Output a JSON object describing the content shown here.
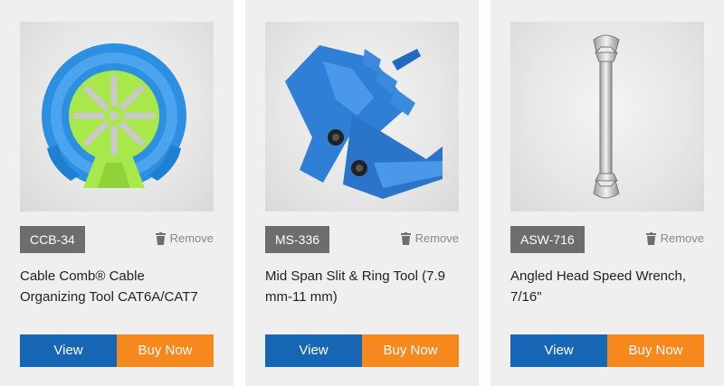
{
  "products": [
    {
      "sku": "CCB-34",
      "remove_label": "Remove",
      "title": "Cable Comb® Cable Organizing Tool CAT6A/CAT7",
      "view_label": "View",
      "buy_label": "Buy Now",
      "image_icon": "cable-comb-tool-image"
    },
    {
      "sku": "MS-336",
      "remove_label": "Remove",
      "title": "Mid Span Slit & Ring Tool (7.9 mm-11 mm)",
      "view_label": "View",
      "buy_label": "Buy Now",
      "image_icon": "slit-ring-tool-image"
    },
    {
      "sku": "ASW-716",
      "remove_label": "Remove",
      "title": "Angled Head Speed Wrench, 7/16\"",
      "view_label": "View",
      "buy_label": "Buy Now",
      "image_icon": "wrench-image"
    }
  ],
  "colors": {
    "view_button": "#1765b5",
    "buy_button": "#f5891e",
    "sku_badge": "#6d6d6d",
    "card_bg": "#f0efef"
  }
}
